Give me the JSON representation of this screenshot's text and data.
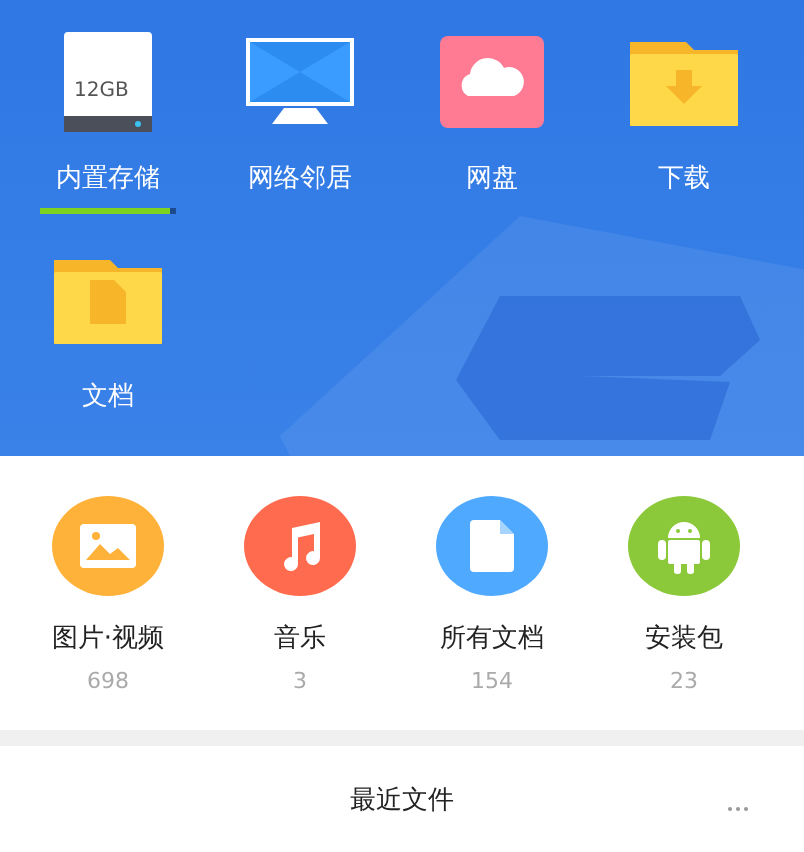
{
  "locations": [
    {
      "label": "内置存储",
      "kind": "storage",
      "capacity": "12GB",
      "level": 0.95
    },
    {
      "label": "网络邻居",
      "kind": "network"
    },
    {
      "label": "网盘",
      "kind": "cloud"
    },
    {
      "label": "下载",
      "kind": "download"
    },
    {
      "label": "文档",
      "kind": "documents"
    }
  ],
  "categories": [
    {
      "label": "图片·视频",
      "count": "698",
      "kind": "image",
      "color": "#ffb23a"
    },
    {
      "label": "音乐",
      "count": "3",
      "kind": "music",
      "color": "#ff6b4f"
    },
    {
      "label": "所有文档",
      "count": "154",
      "kind": "document",
      "color": "#4fa9ff"
    },
    {
      "label": "安装包",
      "count": "23",
      "kind": "apk",
      "color": "#8bc93a"
    }
  ],
  "recent": {
    "title": "最近文件"
  }
}
